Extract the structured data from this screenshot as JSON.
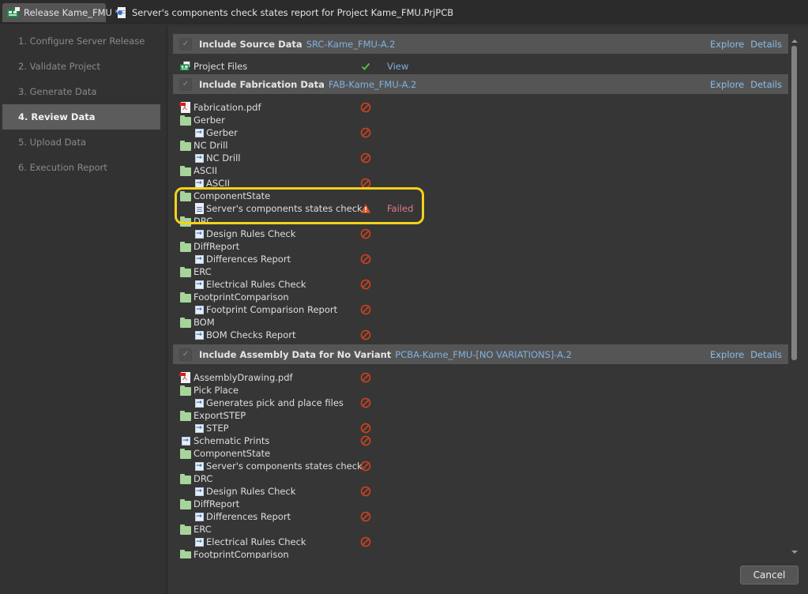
{
  "tabs": [
    {
      "label": "Release Kame_FMU *",
      "icon": "release-icon",
      "active": true
    },
    {
      "label": "Server's components check states report for Project Kame_FMU.PrjPCB",
      "icon": "document-icon",
      "active": false
    }
  ],
  "sidebar": {
    "steps": [
      {
        "label": "1. Configure Server Release",
        "active": false
      },
      {
        "label": "2. Validate Project",
        "active": false
      },
      {
        "label": "3. Generate Data",
        "active": false
      },
      {
        "label": "4. Review Data",
        "active": true
      },
      {
        "label": "5. Upload Data",
        "active": false
      },
      {
        "label": "6. Execution Report",
        "active": false
      }
    ]
  },
  "sections": [
    {
      "title": "Include Source Data",
      "id": "SRC-Kame_FMU-A.2",
      "explore": "Explore",
      "details": "Details",
      "rows": [
        {
          "label": "Project Files",
          "icon": "project-files-icon",
          "level": 0,
          "status": "ok",
          "status_text": "View"
        }
      ]
    },
    {
      "title": "Include Fabrication Data",
      "id": "FAB-Kame_FMU-A.2",
      "explore": "Explore",
      "details": "Details",
      "rows": [
        {
          "label": "Fabrication.pdf",
          "icon": "pdf-icon",
          "level": 0,
          "status": "blocked"
        },
        {
          "label": "Gerber",
          "icon": "folder-icon",
          "level": 0
        },
        {
          "label": "Gerber",
          "icon": "action-icon",
          "level": 1,
          "status": "blocked"
        },
        {
          "label": "NC Drill",
          "icon": "folder-icon",
          "level": 0
        },
        {
          "label": "NC Drill",
          "icon": "action-icon",
          "level": 1,
          "status": "blocked"
        },
        {
          "label": "ASCII",
          "icon": "folder-icon",
          "level": 0
        },
        {
          "label": "ASCII",
          "icon": "action-icon",
          "level": 1,
          "status": "blocked"
        },
        {
          "label": "ComponentState",
          "icon": "folder-icon",
          "level": 0
        },
        {
          "label": "Server's components states check",
          "icon": "document-icon",
          "level": 1,
          "status": "failed",
          "status_text": "Failed"
        },
        {
          "label": "DRC",
          "icon": "folder-icon",
          "level": 0
        },
        {
          "label": "Design Rules Check",
          "icon": "action-icon",
          "level": 1,
          "status": "blocked"
        },
        {
          "label": "DiffReport",
          "icon": "folder-icon",
          "level": 0
        },
        {
          "label": "Differences Report",
          "icon": "action-icon",
          "level": 1,
          "status": "blocked"
        },
        {
          "label": "ERC",
          "icon": "folder-icon",
          "level": 0
        },
        {
          "label": "Electrical Rules Check",
          "icon": "action-icon",
          "level": 1,
          "status": "blocked"
        },
        {
          "label": "FootprintComparison",
          "icon": "folder-icon",
          "level": 0
        },
        {
          "label": "Footprint Comparison Report",
          "icon": "action-icon",
          "level": 1,
          "status": "blocked"
        },
        {
          "label": "BOM",
          "icon": "folder-icon",
          "level": 0
        },
        {
          "label": "BOM Checks Report",
          "icon": "action-icon",
          "level": 1,
          "status": "blocked"
        }
      ]
    },
    {
      "title": "Include Assembly Data for No Variant",
      "id": "PCBA-Kame_FMU-[NO VARIATIONS]-A.2",
      "explore": "Explore",
      "details": "Details",
      "rows": [
        {
          "label": "AssemblyDrawing.pdf",
          "icon": "pdf-icon",
          "level": 0,
          "status": "blocked"
        },
        {
          "label": "Pick Place",
          "icon": "folder-icon",
          "level": 0
        },
        {
          "label": "Generates pick and place files",
          "icon": "action-icon",
          "level": 1,
          "status": "blocked"
        },
        {
          "label": "ExportSTEP",
          "icon": "folder-icon",
          "level": 0
        },
        {
          "label": "STEP",
          "icon": "action-icon",
          "level": 1,
          "status": "blocked"
        },
        {
          "label": "Schematic Prints",
          "icon": "action-icon",
          "level": 0,
          "status": "blocked"
        },
        {
          "label": "ComponentState",
          "icon": "folder-icon",
          "level": 0
        },
        {
          "label": "Server's components states check",
          "icon": "action-icon",
          "level": 1,
          "status": "blocked"
        },
        {
          "label": "DRC",
          "icon": "folder-icon",
          "level": 0
        },
        {
          "label": "Design Rules Check",
          "icon": "action-icon",
          "level": 1,
          "status": "blocked"
        },
        {
          "label": "DiffReport",
          "icon": "folder-icon",
          "level": 0
        },
        {
          "label": "Differences Report",
          "icon": "action-icon",
          "level": 1,
          "status": "blocked"
        },
        {
          "label": "ERC",
          "icon": "folder-icon",
          "level": 0
        },
        {
          "label": "Electrical Rules Check",
          "icon": "action-icon",
          "level": 1,
          "status": "blocked"
        },
        {
          "label": "FootprintComparison",
          "icon": "folder-icon",
          "level": 0
        }
      ]
    }
  ],
  "footer": {
    "cancel_label": "Cancel"
  },
  "colors": {
    "link": "#8bbde9",
    "failed": "#e07a8a",
    "highlight": "#f2d31b",
    "blocked": "#d0421b",
    "ok": "#5fbf3f"
  }
}
